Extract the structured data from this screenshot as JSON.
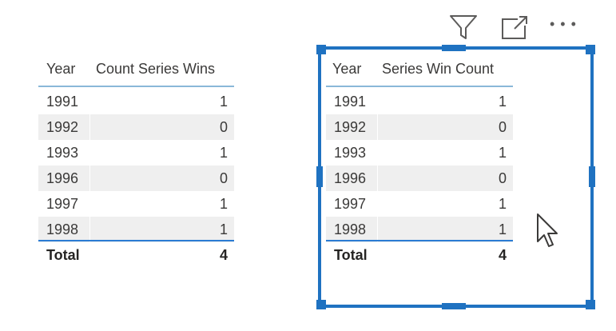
{
  "visual_header": {
    "icons": [
      "filter-icon",
      "focus-mode-icon",
      "more-options-icon"
    ],
    "more_label": "• • •"
  },
  "left_table": {
    "columns": [
      "Year",
      "Count Series Wins"
    ],
    "rows": [
      {
        "year": "1991",
        "value": "1"
      },
      {
        "year": "1992",
        "value": "0"
      },
      {
        "year": "1993",
        "value": "1"
      },
      {
        "year": "1996",
        "value": "0"
      },
      {
        "year": "1997",
        "value": "1"
      },
      {
        "year": "1998",
        "value": "1"
      }
    ],
    "total_label": "Total",
    "total_value": "4"
  },
  "right_table": {
    "columns": [
      "Year",
      "Series Win Count"
    ],
    "rows": [
      {
        "year": "1991",
        "value": "1"
      },
      {
        "year": "1992",
        "value": "0"
      },
      {
        "year": "1993",
        "value": "1"
      },
      {
        "year": "1996",
        "value": "0"
      },
      {
        "year": "1997",
        "value": "1"
      },
      {
        "year": "1998",
        "value": "1"
      }
    ],
    "total_label": "Total",
    "total_value": "4"
  },
  "colors": {
    "selection_border": "#1f72c1",
    "header_underline": "#8ab8d8",
    "total_underline": "#2b7cd3",
    "alt_row": "#efefef"
  }
}
